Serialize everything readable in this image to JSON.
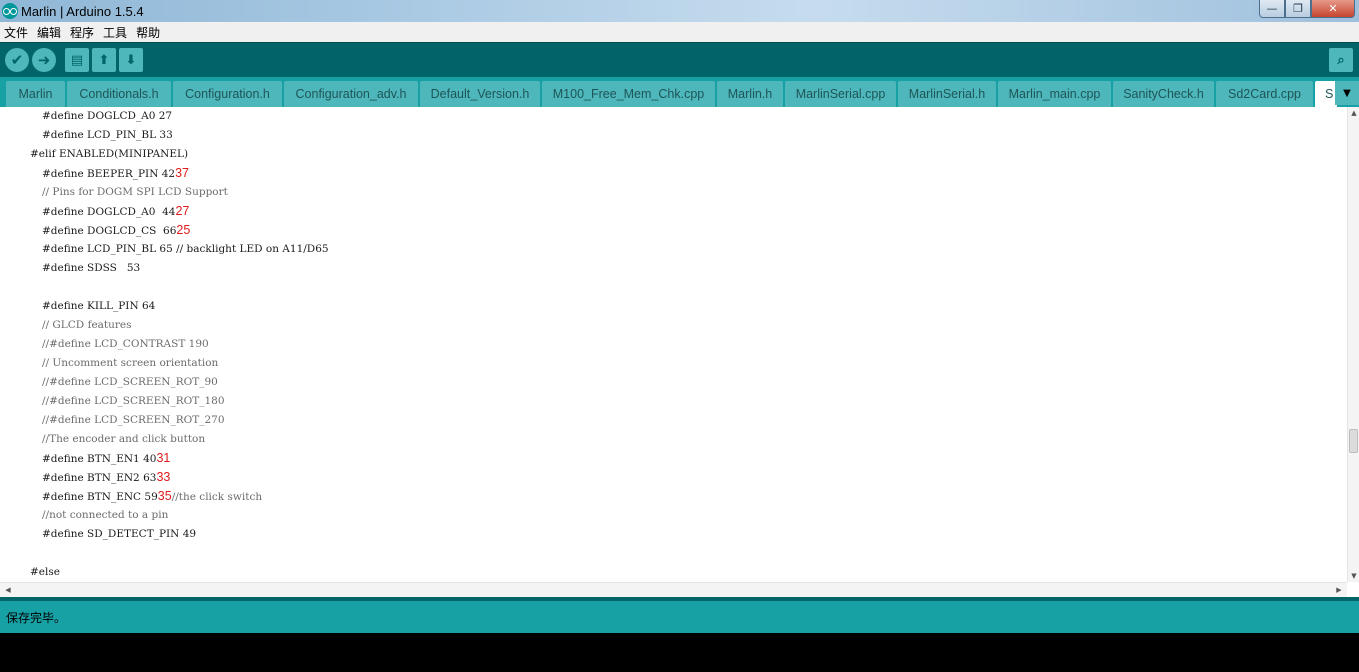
{
  "window": {
    "title": "Marlin | Arduino 1.5.4",
    "min_glyph": "—",
    "max_glyph": "❐",
    "close_glyph": "✕"
  },
  "menu": [
    "文件",
    "编辑",
    "程序",
    "工具",
    "帮助"
  ],
  "toolbar": {
    "verify_glyph": "✔",
    "upload_glyph": "➜",
    "new_glyph": "▤",
    "open_glyph": "⬆",
    "save_glyph": "⬇",
    "serial_glyph": "⌕"
  },
  "tabs": [
    {
      "label": "Marlin",
      "active": false
    },
    {
      "label": "Conditionals.h",
      "active": false
    },
    {
      "label": "Configuration.h",
      "active": false
    },
    {
      "label": "Configuration_adv.h",
      "active": false
    },
    {
      "label": "Default_Version.h",
      "active": false
    },
    {
      "label": "M100_Free_Mem_Chk.cpp",
      "active": false
    },
    {
      "label": "Marlin.h",
      "active": false
    },
    {
      "label": "MarlinSerial.cpp",
      "active": false
    },
    {
      "label": "MarlinSerial.h",
      "active": false
    },
    {
      "label": "Marlin_main.cpp",
      "active": false
    },
    {
      "label": "SanityCheck.h",
      "active": false
    },
    {
      "label": "Sd2Card.cpp",
      "active": false
    },
    {
      "label": "S",
      "active": true
    }
  ],
  "tab_menu_glyph": "▼",
  "code": [
    {
      "text": "#define DOGLCD_A0 27",
      "indent": 1,
      "anno": ""
    },
    {
      "text": "#define LCD_PIN_BL 33",
      "indent": 1,
      "anno": ""
    },
    {
      "text": "#elif ENABLED(MINIPANEL)",
      "indent": 0,
      "anno": ""
    },
    {
      "text": "#define BEEPER_PIN 42",
      "indent": 1,
      "anno": "37"
    },
    {
      "text": "// Pins for DOGM SPI LCD Support",
      "indent": 1,
      "anno": "",
      "comment": true
    },
    {
      "text": "#define DOGLCD_A0  44",
      "indent": 1,
      "anno": "27"
    },
    {
      "text": "#define DOGLCD_CS  66",
      "indent": 1,
      "anno": "25"
    },
    {
      "text": "#define LCD_PIN_BL 65 // backlight LED on A11/D65",
      "indent": 1,
      "anno": ""
    },
    {
      "text": "#define SDSS   53",
      "indent": 1,
      "anno": ""
    },
    {
      "text": "",
      "indent": 0,
      "anno": ""
    },
    {
      "text": "#define KILL_PIN 64",
      "indent": 1,
      "anno": ""
    },
    {
      "text": "// GLCD features",
      "indent": 1,
      "anno": "",
      "comment": true
    },
    {
      "text": "//#define LCD_CONTRAST 190",
      "indent": 1,
      "anno": "",
      "comment": true
    },
    {
      "text": "// Uncomment screen orientation",
      "indent": 1,
      "anno": "",
      "comment": true
    },
    {
      "text": "//#define LCD_SCREEN_ROT_90",
      "indent": 1,
      "anno": "",
      "comment": true
    },
    {
      "text": "//#define LCD_SCREEN_ROT_180",
      "indent": 1,
      "anno": "",
      "comment": true
    },
    {
      "text": "//#define LCD_SCREEN_ROT_270",
      "indent": 1,
      "anno": "",
      "comment": true
    },
    {
      "text": "//The encoder and click button",
      "indent": 1,
      "anno": "",
      "comment": true
    },
    {
      "text": "#define BTN_EN1 40",
      "indent": 1,
      "anno": "31"
    },
    {
      "text": "#define BTN_EN2 63",
      "indent": 1,
      "anno": "33"
    },
    {
      "text": "#define BTN_ENC 59",
      "indent": 1,
      "anno": "35",
      "after": "//the click switch"
    },
    {
      "text": "//not connected to a pin",
      "indent": 1,
      "anno": "",
      "comment": true
    },
    {
      "text": "#define SD_DETECT_PIN 49",
      "indent": 1,
      "anno": ""
    },
    {
      "text": "",
      "indent": 0,
      "anno": ""
    },
    {
      "text": "#else",
      "indent": 0,
      "anno": ""
    }
  ],
  "status": {
    "message": "保存完毕。"
  },
  "scroll": {
    "up_glyph": "▲",
    "down_glyph": "▼",
    "left_glyph": "◀",
    "right_glyph": "▶"
  }
}
